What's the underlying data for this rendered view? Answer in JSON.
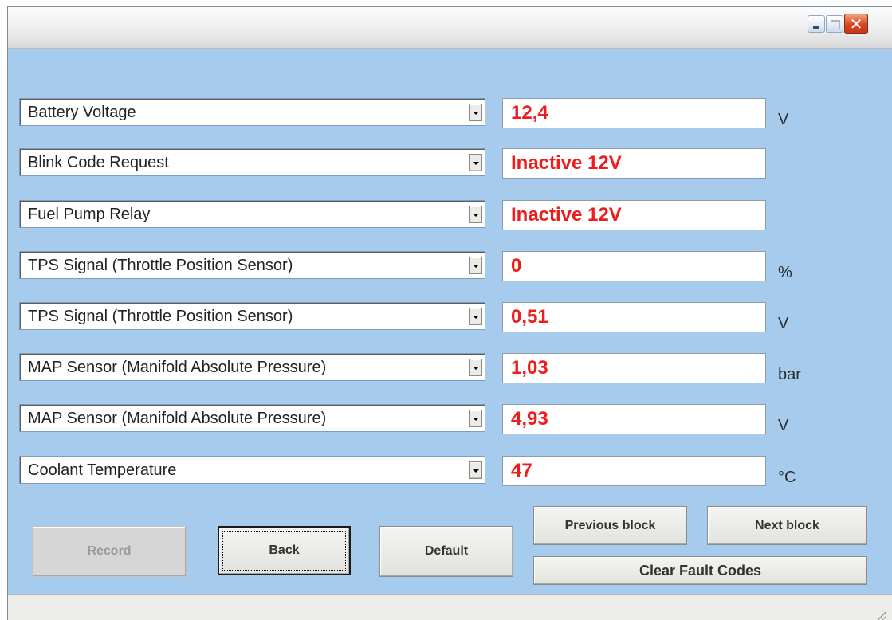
{
  "window": {
    "controls": {
      "minimize_icon": "minimize-icon",
      "maximize_icon": "maximize-icon",
      "close_icon": "close-icon",
      "close_glyph": "✕"
    }
  },
  "rows": [
    {
      "parameter": "Battery Voltage",
      "value": "12,4",
      "unit": "V"
    },
    {
      "parameter": "Blink Code Request",
      "value": "Inactive 12V",
      "unit": ""
    },
    {
      "parameter": "Fuel Pump Relay",
      "value": "Inactive 12V",
      "unit": ""
    },
    {
      "parameter": "TPS Signal (Throttle Position Sensor)",
      "value": "0",
      "unit": "%"
    },
    {
      "parameter": "TPS Signal (Throttle Position Sensor)",
      "value": "0,51",
      "unit": "V"
    },
    {
      "parameter": "MAP Sensor (Manifold Absolute Pressure)",
      "value": "1,03",
      "unit": "bar"
    },
    {
      "parameter": "MAP Sensor (Manifold Absolute Pressure)",
      "value": "4,93",
      "unit": "V"
    },
    {
      "parameter": "Coolant Temperature",
      "value": "47",
      "unit": "°C"
    }
  ],
  "buttons": {
    "record": "Record",
    "back": "Back",
    "default": "Default",
    "previous_block": "Previous block",
    "next_block": "Next block",
    "clear_fault_codes": "Clear Fault Codes"
  },
  "colors": {
    "window_background": "#a6cbec",
    "value_text": "#ef1c1c",
    "disabled_text": "#9a9a9a"
  }
}
